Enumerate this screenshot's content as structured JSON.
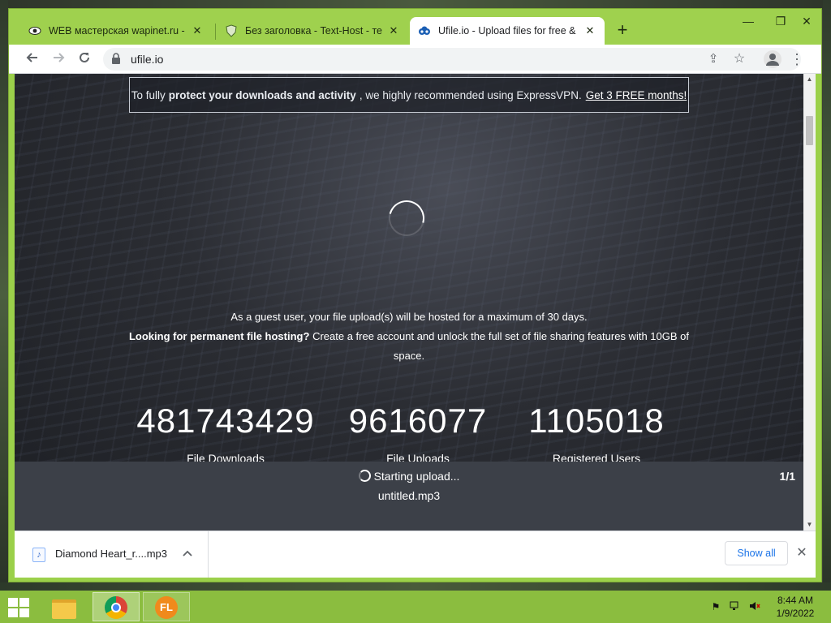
{
  "browser": {
    "tabs": [
      {
        "title": "WEB мастерская wapinet.ru - Фа",
        "favicon": "eye-icon"
      },
      {
        "title": "Без заголовка - Text-Host - текс",
        "favicon": "shield-icon"
      },
      {
        "title": "Ufile.io - Upload files for free & s",
        "favicon": "ufile-icon",
        "active": true
      }
    ],
    "url": "ufile.io"
  },
  "page": {
    "banner": {
      "prefix": "To fully",
      "bold": "protect your downloads and activity",
      "suffix": ", we highly recommended using ExpressVPN.",
      "link": "Get 3 FREE months!"
    },
    "info_line1": "As a guest user, your file upload(s) will be hosted for a maximum of 30 days.",
    "info_bold": "Looking for permanent file hosting?",
    "info_rest": "Create a free account and unlock the full set of file sharing features with 10GB of space.",
    "stats": [
      {
        "value": "481743429",
        "label": "File Downloads"
      },
      {
        "value": "9616077",
        "label": "File Uploads"
      },
      {
        "value": "1105018",
        "label": "Registered Users"
      }
    ],
    "upload": {
      "status": "Starting upload...",
      "filename": "untitled.mp3",
      "count": "1/1"
    }
  },
  "downloads": {
    "item_name": "Diamond Heart_r....mp3",
    "show_all": "Show all"
  },
  "taskbar": {
    "time": "8:44 AM",
    "date": "1/9/2022"
  },
  "colors": {
    "chrome_frame": "#9fd14e",
    "taskbar": "#8bbd3f",
    "upload_bar": "#3c4048",
    "link_blue": "#1a73e8"
  }
}
